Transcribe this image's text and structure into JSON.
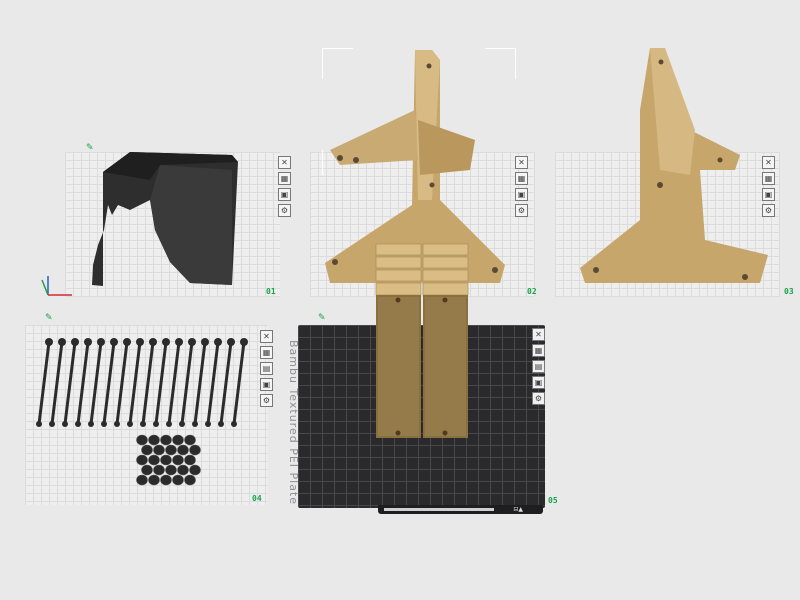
{
  "plates": [
    {
      "number": "01"
    },
    {
      "number": "02"
    },
    {
      "number": "03"
    },
    {
      "number": "04"
    },
    {
      "number": "05"
    }
  ],
  "plate_tool_icons": [
    "close-icon",
    "arrange-icon",
    "slice-icon",
    "lock-icon",
    "settings-icon"
  ],
  "bed_label": "Bambu Textured PEI Plate",
  "colors": {
    "accent_green": "#1aa34a",
    "model_wood": "#c8a86e",
    "model_black": "#2b2b2b",
    "plate_light": "#eeeeee",
    "plate_dark": "#2a2a2c"
  }
}
